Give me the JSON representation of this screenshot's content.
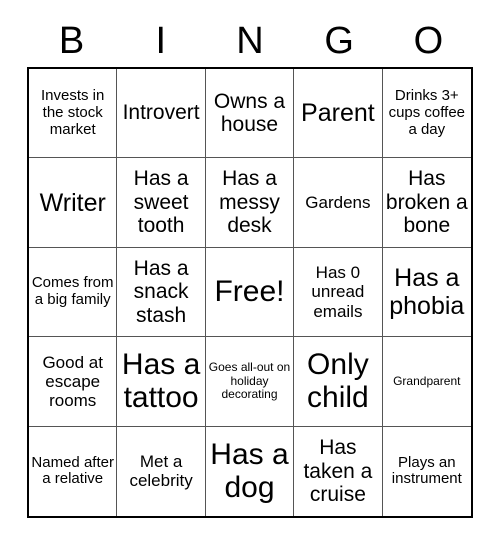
{
  "card": {
    "title_letters": [
      "B",
      "I",
      "N",
      "G",
      "O"
    ],
    "rows": [
      [
        {
          "text": "Invests in the stock market",
          "size": "fs-sm"
        },
        {
          "text": "Introvert",
          "size": "fs-lg"
        },
        {
          "text": "Owns a house",
          "size": "fs-lg"
        },
        {
          "text": "Parent",
          "size": "fs-xl"
        },
        {
          "text": "Drinks 3+ cups coffee a day",
          "size": "fs-sm"
        }
      ],
      [
        {
          "text": "Writer",
          "size": "fs-xl"
        },
        {
          "text": "Has a sweet tooth",
          "size": "fs-lg"
        },
        {
          "text": "Has a messy desk",
          "size": "fs-lg"
        },
        {
          "text": "Gardens",
          "size": "fs-md"
        },
        {
          "text": "Has broken a bone",
          "size": "fs-lg"
        }
      ],
      [
        {
          "text": "Comes from a big family",
          "size": "fs-sm"
        },
        {
          "text": "Has a snack stash",
          "size": "fs-lg"
        },
        {
          "text": "Free!",
          "size": "fs-xxl"
        },
        {
          "text": "Has 0 unread emails",
          "size": "fs-md"
        },
        {
          "text": "Has a phobia",
          "size": "fs-xl"
        }
      ],
      [
        {
          "text": "Good at escape rooms",
          "size": "fs-md"
        },
        {
          "text": "Has a tattoo",
          "size": "fs-xxl"
        },
        {
          "text": "Goes all-out on holiday decorating",
          "size": "fs-xs"
        },
        {
          "text": "Only child",
          "size": "fs-xxl"
        },
        {
          "text": "Grandparent",
          "size": "fs-xs"
        }
      ],
      [
        {
          "text": "Named after a relative",
          "size": "fs-sm"
        },
        {
          "text": "Met a celebrity",
          "size": "fs-md"
        },
        {
          "text": "Has a dog",
          "size": "fs-xxl"
        },
        {
          "text": "Has taken a cruise",
          "size": "fs-lg"
        },
        {
          "text": "Plays an instrument",
          "size": "fs-sm"
        }
      ]
    ]
  }
}
